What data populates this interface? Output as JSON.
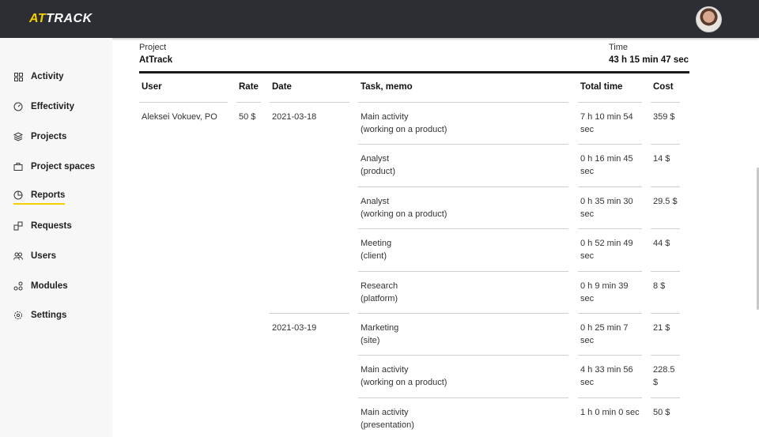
{
  "app": {
    "logo_prefix": "AT",
    "logo_suffix": "TRACK"
  },
  "sidebar": {
    "items": [
      {
        "label": "Activity",
        "icon": "grid-icon"
      },
      {
        "label": "Effectivity",
        "icon": "gauge-icon"
      },
      {
        "label": "Projects",
        "icon": "layers-icon"
      },
      {
        "label": "Project spaces",
        "icon": "briefcase-icon"
      },
      {
        "label": "Reports",
        "icon": "pie-chart-icon",
        "active": true
      },
      {
        "label": "Requests",
        "icon": "requests-icon"
      },
      {
        "label": "Users",
        "icon": "users-icon"
      },
      {
        "label": "Modules",
        "icon": "modules-icon"
      },
      {
        "label": "Settings",
        "icon": "gear-icon"
      }
    ]
  },
  "summary": {
    "project_label": "Project",
    "project_value": "AtTrack",
    "time_label": "Time",
    "time_value": "43 h 15 min 47 sec"
  },
  "table": {
    "headers": {
      "user": "User",
      "rate": "Rate",
      "date": "Date",
      "task": "Task, memo",
      "total": "Total time",
      "cost": "Cost"
    },
    "user": "Aleksei Vokuev, PO",
    "rate": "50 $",
    "dates": [
      "2021-03-18",
      "2021-03-19"
    ],
    "rows": [
      {
        "task": "Main activity",
        "memo": "(working on a product)",
        "time_1": "7 h 10 min 54",
        "time_2": "sec",
        "cost_1": "359 $",
        "cost_2": ""
      },
      {
        "task": "Analyst",
        "memo": "(product)",
        "time_1": "0 h 16 min 45",
        "time_2": "sec",
        "cost_1": "14 $",
        "cost_2": ""
      },
      {
        "task": "Analyst",
        "memo": "(working on a product)",
        "time_1": "0 h 35 min 30",
        "time_2": "sec",
        "cost_1": "29.5 $",
        "cost_2": ""
      },
      {
        "task": "Meeting",
        "memo": "(client)",
        "time_1": "0 h 52 min 49",
        "time_2": "sec",
        "cost_1": "44 $",
        "cost_2": ""
      },
      {
        "task": "Research",
        "memo": "(platform)",
        "time_1": "0 h 9 min 39",
        "time_2": "sec",
        "cost_1": "8 $",
        "cost_2": ""
      },
      {
        "task": "Marketing",
        "memo": "(site)",
        "time_1": "0 h 25 min 7",
        "time_2": "sec",
        "cost_1": "21 $",
        "cost_2": ""
      },
      {
        "task": "Main activity",
        "memo": "(working on a product)",
        "time_1": "4 h 33 min 56",
        "time_2": "sec",
        "cost_1": "228.5",
        "cost_2": "$"
      },
      {
        "task": "Main activity",
        "memo": "(presentation)",
        "time_1": "1 h 0 min 0 sec",
        "time_2": "",
        "cost_1": "50 $",
        "cost_2": ""
      }
    ]
  },
  "colors": {
    "topbar": "#2c2e33",
    "accent": "#f5d000",
    "sidebar": "#f7f7f8"
  }
}
